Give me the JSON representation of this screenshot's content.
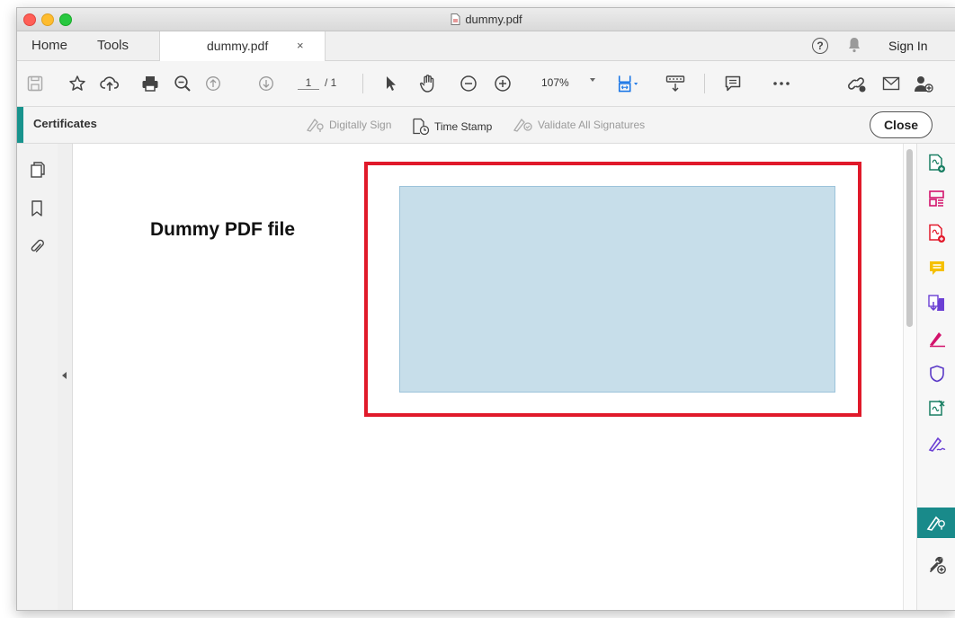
{
  "window": {
    "title": "dummy.pdf"
  },
  "tabs": {
    "home": "Home",
    "tools": "Tools",
    "document": "dummy.pdf",
    "close_symbol": "×",
    "help_symbol": "?",
    "sign_in": "Sign In"
  },
  "toolbar": {
    "page_current": "1",
    "page_total": "/ 1",
    "zoom": "107%"
  },
  "certificates": {
    "title": "Certificates",
    "digitally_sign": "Digitally Sign",
    "time_stamp": "Time Stamp",
    "validate_all": "Validate All Signatures",
    "close": "Close"
  },
  "document": {
    "heading": "Dummy PDF file"
  },
  "colors": {
    "accent": "#18938d",
    "signature_border": "#e0192a",
    "signature_field": "#c7deea"
  },
  "right_tools": [
    "create-pdf-icon",
    "organize-pages-icon",
    "export-pdf-icon",
    "comment-icon",
    "send-for-review-icon",
    "fill-sign-icon",
    "protect-icon",
    "edit-pdf-icon",
    "sign-icon",
    "certificates-icon",
    "more-tools-icon"
  ]
}
